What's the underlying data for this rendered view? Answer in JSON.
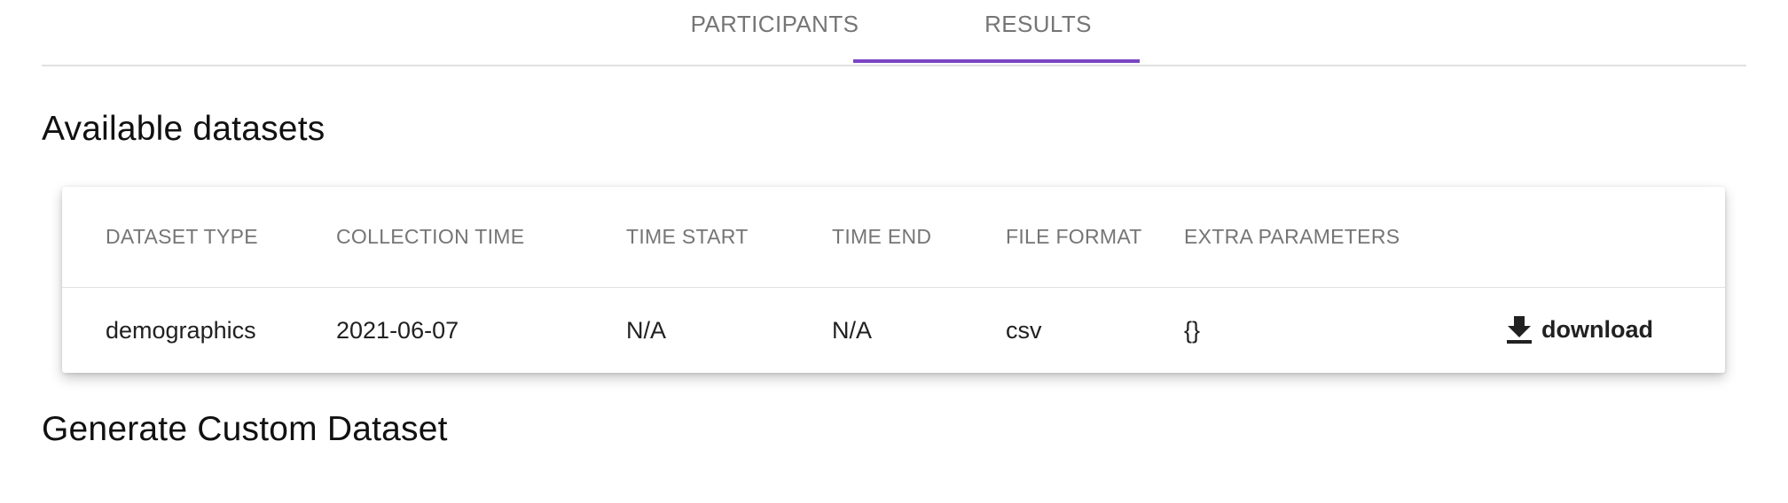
{
  "tabs": [
    {
      "label": "PARTICIPANTS",
      "active": false
    },
    {
      "label": "RESULTS",
      "active": true
    }
  ],
  "colors": {
    "accent": "#7b44c4",
    "header_text": "#757575",
    "body_text": "#212121"
  },
  "available_datasets": {
    "title": "Available datasets",
    "columns": [
      "DATASET TYPE",
      "COLLECTION TIME",
      "TIME START",
      "TIME END",
      "FILE FORMAT",
      "EXTRA PARAMETERS"
    ],
    "rows": [
      {
        "dataset_type": "demographics",
        "collection_time": "2021-06-07",
        "time_start": "N/A",
        "time_end": "N/A",
        "file_format": "csv",
        "extra_parameters": "{}",
        "action": {
          "label": "download",
          "icon": "download-icon"
        }
      }
    ]
  },
  "custom_dataset": {
    "title": "Generate Custom Dataset"
  }
}
